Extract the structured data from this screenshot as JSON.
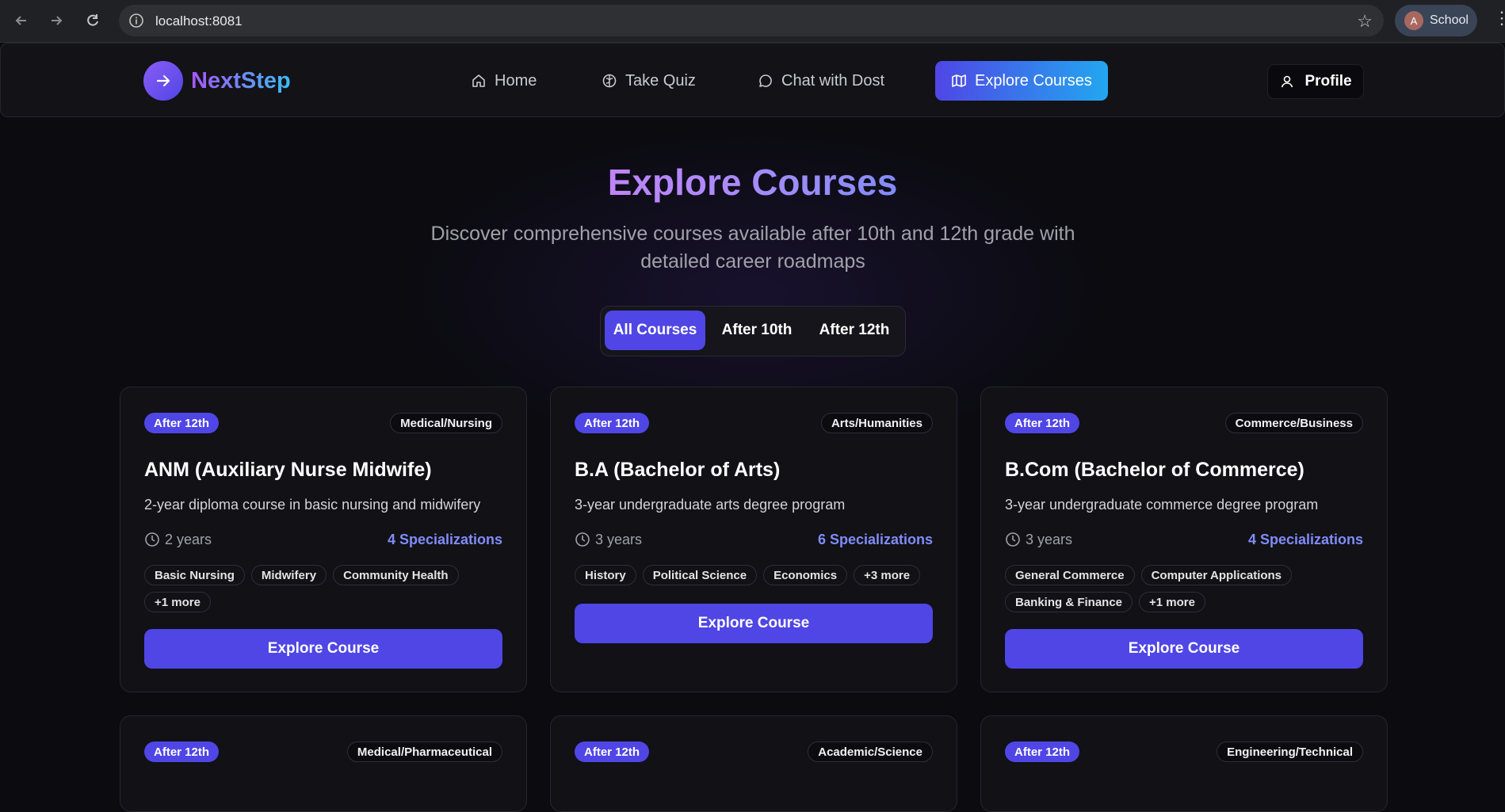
{
  "browser": {
    "url": "localhost:8081",
    "profile_initial": "A",
    "profile_name": "School"
  },
  "brand": {
    "name": "NextStep"
  },
  "nav": [
    {
      "label": "Home",
      "icon": "home-icon"
    },
    {
      "label": "Take Quiz",
      "icon": "brain-icon"
    },
    {
      "label": "Chat with Dost",
      "icon": "chat-bubble-icon"
    },
    {
      "label": "Explore Courses",
      "icon": "map-icon",
      "active": true
    }
  ],
  "profile_button": {
    "label": "Profile",
    "icon": "user-icon"
  },
  "page": {
    "title": "Explore Courses",
    "subtitle": "Discover comprehensive courses available after 10th and 12th grade with detailed career roadmaps"
  },
  "filters": [
    {
      "label": "All Courses",
      "active": true
    },
    {
      "label": "After 10th"
    },
    {
      "label": "After 12th"
    }
  ],
  "courses": [
    {
      "level": "After 12th",
      "category": "Medical/Nursing",
      "title": "ANM (Auxiliary Nurse Midwife)",
      "description": "2-year diploma course in basic nursing and midwifery",
      "duration": "2 years",
      "specializations": "4 Specializations",
      "tags": [
        "Basic Nursing",
        "Midwifery",
        "Community Health",
        "+1 more"
      ],
      "button": "Explore Course"
    },
    {
      "level": "After 12th",
      "category": "Arts/Humanities",
      "title": "B.A (Bachelor of Arts)",
      "description": "3-year undergraduate arts degree program",
      "duration": "3 years",
      "specializations": "6 Specializations",
      "tags": [
        "History",
        "Political Science",
        "Economics",
        "+3 more"
      ],
      "button": "Explore Course"
    },
    {
      "level": "After 12th",
      "category": "Commerce/Business",
      "title": "B.Com (Bachelor of Commerce)",
      "description": "3-year undergraduate commerce degree program",
      "duration": "3 years",
      "specializations": "4 Specializations",
      "tags": [
        "General Commerce",
        "Computer Applications",
        "Banking & Finance",
        "+1 more"
      ],
      "button": "Explore Course"
    },
    {
      "level": "After 12th",
      "category": "Medical/Pharmaceutical"
    },
    {
      "level": "After 12th",
      "category": "Academic/Science"
    },
    {
      "level": "After 12th",
      "category": "Engineering/Technical"
    }
  ],
  "colors": {
    "accent": "#4f46e5",
    "accent_gradient_end": "#22a7f0",
    "background": "#0b0b10",
    "card": "#111116",
    "specialization_text": "#818cf8"
  }
}
